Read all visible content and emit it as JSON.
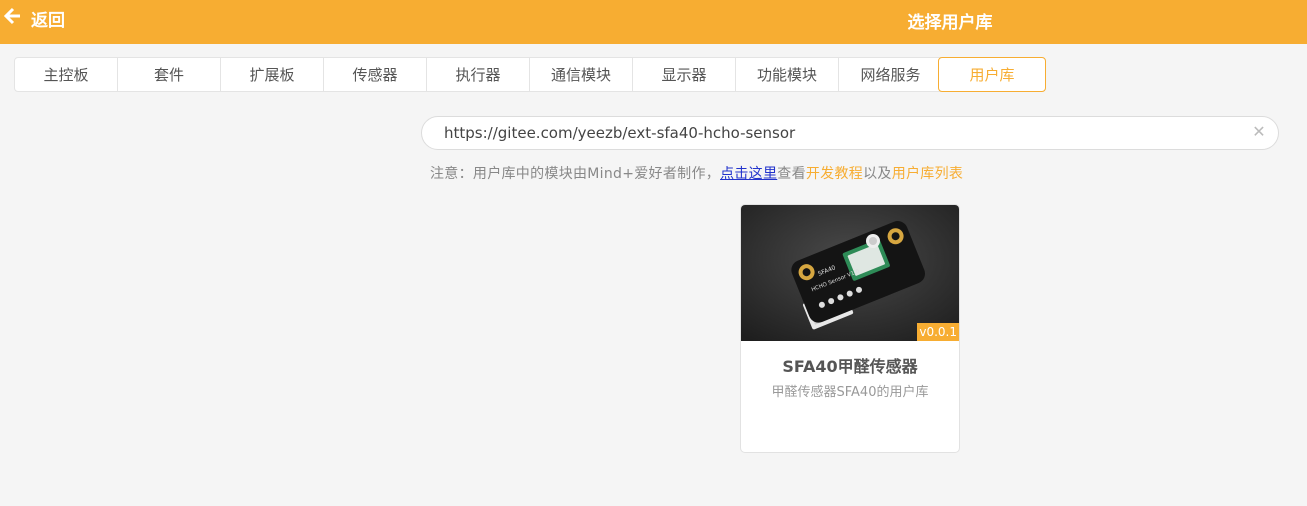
{
  "header": {
    "back_label": "返回",
    "title": "选择用户库",
    "back_icon": "arrow-left-icon"
  },
  "tabs": [
    {
      "label": "主控板",
      "active": false
    },
    {
      "label": "套件",
      "active": false
    },
    {
      "label": "扩展板",
      "active": false
    },
    {
      "label": "传感器",
      "active": false
    },
    {
      "label": "执行器",
      "active": false
    },
    {
      "label": "通信模块",
      "active": false
    },
    {
      "label": "显示器",
      "active": false
    },
    {
      "label": "功能模块",
      "active": false
    },
    {
      "label": "网络服务",
      "active": false
    },
    {
      "label": "用户库",
      "active": true
    }
  ],
  "search": {
    "value": "https://gitee.com/yeezb/ext-sfa40-hcho-sensor",
    "clear_icon": "close-icon"
  },
  "note": {
    "prefix": "注意：用户库中的模块由Mind+爱好者制作，",
    "link_label": "点击这里",
    "middle": "查看",
    "tutorial_label": "开发教程",
    "conj": "以及",
    "list_label": "用户库列表"
  },
  "cards": [
    {
      "title": "SFA40甲醛传感器",
      "description": "甲醛传感器SFA40的用户库",
      "version": "v0.0.1",
      "board_label_1": "SFA40",
      "board_label_2": "HCHO Sensor V1.0"
    }
  ],
  "colors": {
    "accent": "#f7ad32",
    "link": "#2233cc"
  }
}
